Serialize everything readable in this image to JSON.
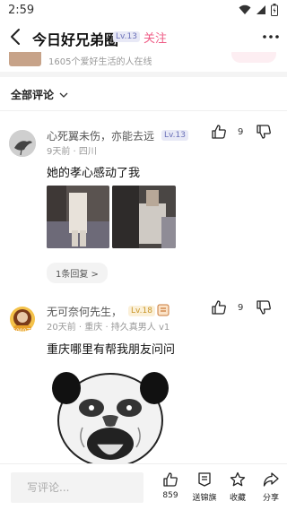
{
  "status": {
    "time": "2:59"
  },
  "header": {
    "title": "今日好兄弟圈",
    "level": "Lv.13",
    "follow_label": "关注"
  },
  "club": {
    "description": "1605个爱好生活的人在线"
  },
  "sort": {
    "label": "全部评论"
  },
  "comments": [
    {
      "name": "心死翼未伤，亦能去远",
      "level": "Lv.13",
      "meta": "9天前 · 四川",
      "text": "她的孝心感动了我",
      "likes": "9",
      "reply_label": "1条回复 >"
    },
    {
      "name": "无可奈何先生，",
      "level": "Lv.18",
      "meta": "20天前 · 重庆 · 持久真男人 v1",
      "text": "重庆哪里有帮我朋友问问",
      "likes": "9",
      "avatar_badge": "6000天"
    }
  ],
  "bottom": {
    "input_placeholder": "写评论...",
    "actions": [
      {
        "label": "859",
        "icon": "thumbs-up-icon"
      },
      {
        "label": "送锦旗",
        "icon": "banner-icon"
      },
      {
        "label": "收藏",
        "icon": "star-icon"
      },
      {
        "label": "分享",
        "icon": "share-icon"
      }
    ]
  },
  "colors": {
    "accent": "#ef5c86",
    "level_blue": "#6a70b8",
    "level_gold": "#c9962a"
  }
}
